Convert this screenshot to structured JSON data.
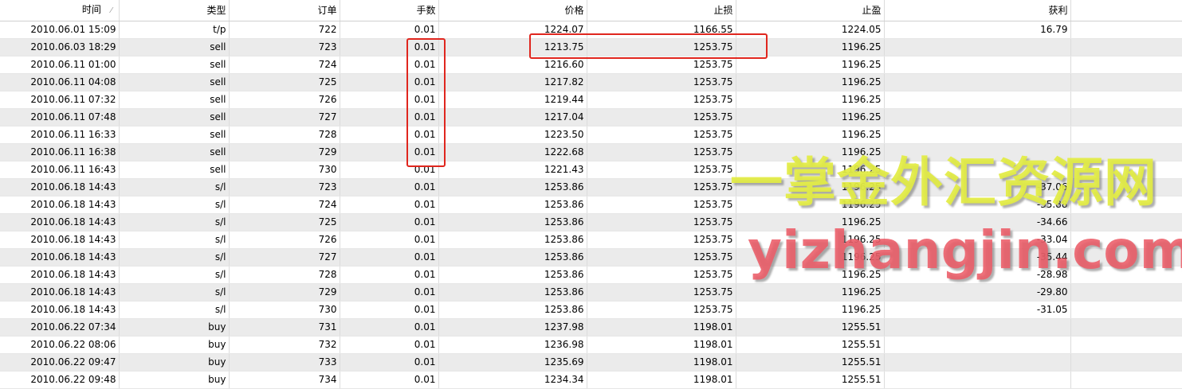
{
  "columns": [
    {
      "label": "时间",
      "sort_icon": "sort-indicator-icon"
    },
    {
      "label": "类型"
    },
    {
      "label": "订单"
    },
    {
      "label": "手数"
    },
    {
      "label": "价格"
    },
    {
      "label": "止损"
    },
    {
      "label": "止盈"
    },
    {
      "label": "获利"
    }
  ],
  "sort_glyph": "⁄",
  "rows": [
    {
      "time": "2010.06.01 15:09",
      "type": "t/p",
      "order": "722",
      "lots": "0.01",
      "price": "1224.07",
      "sl": "1166.55",
      "tp": "1224.05",
      "profit": "16.79"
    },
    {
      "time": "2010.06.03 18:29",
      "type": "sell",
      "order": "723",
      "lots": "0.01",
      "price": "1213.75",
      "sl": "1253.75",
      "tp": "1196.25",
      "profit": ""
    },
    {
      "time": "2010.06.11 01:00",
      "type": "sell",
      "order": "724",
      "lots": "0.01",
      "price": "1216.60",
      "sl": "1253.75",
      "tp": "1196.25",
      "profit": ""
    },
    {
      "time": "2010.06.11 04:08",
      "type": "sell",
      "order": "725",
      "lots": "0.01",
      "price": "1217.82",
      "sl": "1253.75",
      "tp": "1196.25",
      "profit": ""
    },
    {
      "time": "2010.06.11 07:32",
      "type": "sell",
      "order": "726",
      "lots": "0.01",
      "price": "1219.44",
      "sl": "1253.75",
      "tp": "1196.25",
      "profit": ""
    },
    {
      "time": "2010.06.11 07:48",
      "type": "sell",
      "order": "727",
      "lots": "0.01",
      "price": "1217.04",
      "sl": "1253.75",
      "tp": "1196.25",
      "profit": ""
    },
    {
      "time": "2010.06.11 16:33",
      "type": "sell",
      "order": "728",
      "lots": "0.01",
      "price": "1223.50",
      "sl": "1253.75",
      "tp": "1196.25",
      "profit": ""
    },
    {
      "time": "2010.06.11 16:38",
      "type": "sell",
      "order": "729",
      "lots": "0.01",
      "price": "1222.68",
      "sl": "1253.75",
      "tp": "1196.25",
      "profit": ""
    },
    {
      "time": "2010.06.11 16:43",
      "type": "sell",
      "order": "730",
      "lots": "0.01",
      "price": "1221.43",
      "sl": "1253.75",
      "tp": "1196.25",
      "profit": ""
    },
    {
      "time": "2010.06.18 14:43",
      "type": "s/l",
      "order": "723",
      "lots": "0.01",
      "price": "1253.86",
      "sl": "1253.75",
      "tp": "1196.25",
      "profit": "-37.06"
    },
    {
      "time": "2010.06.18 14:43",
      "type": "s/l",
      "order": "724",
      "lots": "0.01",
      "price": "1253.86",
      "sl": "1253.75",
      "tp": "1196.25",
      "profit": "-35.88"
    },
    {
      "time": "2010.06.18 14:43",
      "type": "s/l",
      "order": "725",
      "lots": "0.01",
      "price": "1253.86",
      "sl": "1253.75",
      "tp": "1196.25",
      "profit": "-34.66"
    },
    {
      "time": "2010.06.18 14:43",
      "type": "s/l",
      "order": "726",
      "lots": "0.01",
      "price": "1253.86",
      "sl": "1253.75",
      "tp": "1196.25",
      "profit": "-33.04"
    },
    {
      "time": "2010.06.18 14:43",
      "type": "s/l",
      "order": "727",
      "lots": "0.01",
      "price": "1253.86",
      "sl": "1253.75",
      "tp": "1196.25",
      "profit": "-35.44"
    },
    {
      "time": "2010.06.18 14:43",
      "type": "s/l",
      "order": "728",
      "lots": "0.01",
      "price": "1253.86",
      "sl": "1253.75",
      "tp": "1196.25",
      "profit": "-28.98"
    },
    {
      "time": "2010.06.18 14:43",
      "type": "s/l",
      "order": "729",
      "lots": "0.01",
      "price": "1253.86",
      "sl": "1253.75",
      "tp": "1196.25",
      "profit": "-29.80"
    },
    {
      "time": "2010.06.18 14:43",
      "type": "s/l",
      "order": "730",
      "lots": "0.01",
      "price": "1253.86",
      "sl": "1253.75",
      "tp": "1196.25",
      "profit": "-31.05"
    },
    {
      "time": "2010.06.22 07:34",
      "type": "buy",
      "order": "731",
      "lots": "0.01",
      "price": "1237.98",
      "sl": "1198.01",
      "tp": "1255.51",
      "profit": ""
    },
    {
      "time": "2010.06.22 08:06",
      "type": "buy",
      "order": "732",
      "lots": "0.01",
      "price": "1236.98",
      "sl": "1198.01",
      "tp": "1255.51",
      "profit": ""
    },
    {
      "time": "2010.06.22 09:47",
      "type": "buy",
      "order": "733",
      "lots": "0.01",
      "price": "1235.69",
      "sl": "1198.01",
      "tp": "1255.51",
      "profit": ""
    },
    {
      "time": "2010.06.22 09:48",
      "type": "buy",
      "order": "734",
      "lots": "0.01",
      "price": "1234.34",
      "sl": "1198.01",
      "tp": "1255.51",
      "profit": ""
    }
  ],
  "watermark": {
    "cn": "一掌金外汇资源网",
    "url": "yizhangjin.com"
  },
  "colors": {
    "highlight_box": "#e0261e",
    "alt_row": "#ebebeb",
    "watermark_cn": "#e2ec44",
    "watermark_url": "#ec5c68"
  }
}
